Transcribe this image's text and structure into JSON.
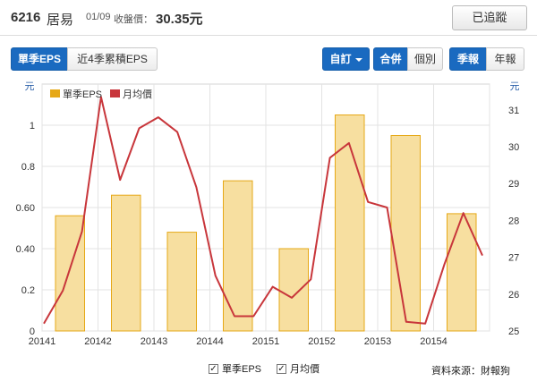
{
  "header": {
    "code": "6216",
    "name": "居易",
    "date": "01/09",
    "price_label": "收盤價：",
    "price": "30.35元",
    "track_button": "已追蹤"
  },
  "tabs": {
    "eps_types": [
      "單季EPS",
      "近4季累積EPS"
    ],
    "custom": "自訂",
    "scope": [
      "合併",
      "個別"
    ],
    "period": [
      "季報",
      "年報"
    ]
  },
  "colors": {
    "accent": "#1a6ac0",
    "bar_fill": "#f7dfa0",
    "bar_stroke": "#e6a817",
    "line": "#c8363b"
  },
  "chart_data": {
    "type": "bar",
    "left_axis_unit": "元",
    "right_axis_unit": "元",
    "left_ticks": [
      "0",
      "0.2",
      "0.40",
      "0.60",
      "0.8",
      "1"
    ],
    "right_ticks": [
      "25",
      "26",
      "27",
      "28",
      "29",
      "30",
      "31"
    ],
    "ylim_left": [
      0,
      1.2
    ],
    "ylim_right": [
      25,
      31.7
    ],
    "grid": true,
    "legend_position": "top-left",
    "x_tick_labels": [
      "20141",
      "20142",
      "20143",
      "20144",
      "20151",
      "20152",
      "20153",
      "20154"
    ],
    "series": [
      {
        "name": "單季EPS",
        "kind": "bar",
        "categories": [
          "20141",
          "20142",
          "20143",
          "20144",
          "20151",
          "20152",
          "20153",
          "20154"
        ],
        "values": [
          0.56,
          0.66,
          0.48,
          0.73,
          0.4,
          1.05,
          0.95,
          0.57
        ]
      },
      {
        "name": "月均價",
        "kind": "line",
        "axis": "right",
        "values": [
          25.2,
          26.1,
          27.7,
          31.35,
          29.1,
          30.5,
          30.8,
          30.4,
          28.9,
          26.5,
          25.4,
          25.4,
          26.2,
          25.9,
          26.4,
          29.7,
          30.1,
          28.5,
          28.35,
          25.25,
          25.2,
          26.8,
          28.2,
          27.05
        ]
      }
    ]
  },
  "footer": {
    "legend": [
      "單季EPS",
      "月均價"
    ],
    "check_mark": "✓",
    "source": "資料來源：財報狗"
  }
}
